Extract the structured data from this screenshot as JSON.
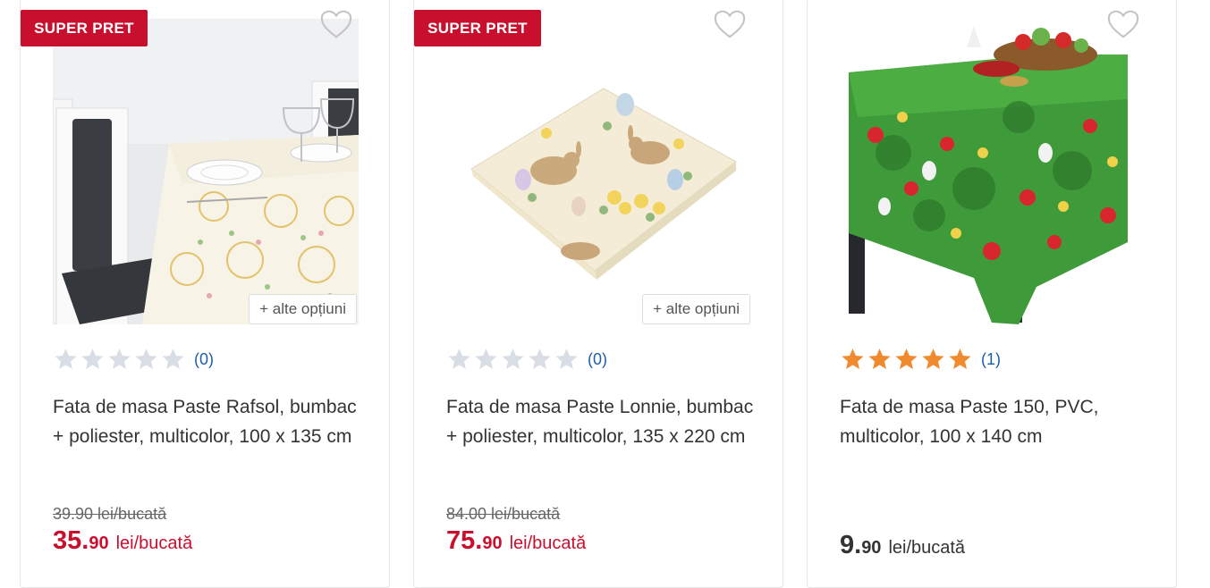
{
  "colors": {
    "accent": "#c8102e",
    "star_active": "#f08a2e",
    "star_inactive": "#d8dde6",
    "link": "#1e5fa8"
  },
  "products": [
    {
      "badge": "SUPER PRET",
      "options_label": "+ alte opțiuni",
      "rating": 0,
      "reviews": "(0)",
      "title": "Fata de masa Paste Rafsol, bumbac + poliester, multicolor, 100 x 135 cm",
      "old_price": "39.90 lei/bucată",
      "price_int": "35.",
      "price_dec": "90",
      "price_unit": "lei/bucată"
    },
    {
      "badge": "SUPER PRET",
      "options_label": "+ alte opțiuni",
      "rating": 0,
      "reviews": "(0)",
      "title": "Fata de masa Paste Lonnie, bumbac + poliester, multicolor, 135 x 220 cm",
      "old_price": "84.00 lei/bucată",
      "price_int": "75.",
      "price_dec": "90",
      "price_unit": "lei/bucată"
    },
    {
      "rating": 5,
      "reviews": "(1)",
      "title": "Fata de masa Paste 150, PVC, multicolor, 100 x 140 cm",
      "price_int": "9.",
      "price_dec": "90",
      "price_unit": "lei/bucată"
    }
  ],
  "icons": {
    "favorite": "heart-outline-icon",
    "star": "star-icon"
  }
}
